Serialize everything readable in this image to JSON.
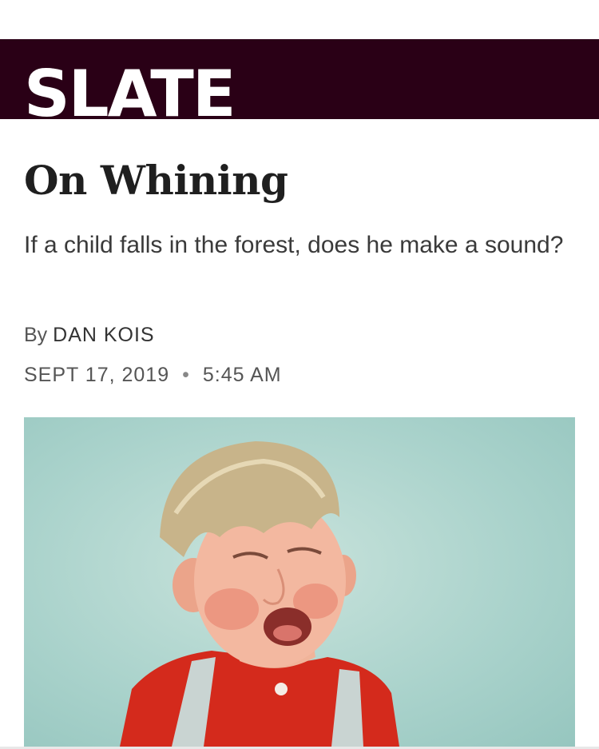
{
  "site": {
    "logo_text": "SLATE",
    "brand_color": "#2a0016"
  },
  "article": {
    "headline": "On Whining",
    "dek": "If a child falls in the forest, does he make a sound?",
    "byline_prefix": "By",
    "author": "DAN KOIS",
    "date": "SEPT 17, 2019",
    "separator": "•",
    "time": "5:45 AM"
  },
  "image": {
    "subject": "photo of a crying young boy in red shirt"
  }
}
